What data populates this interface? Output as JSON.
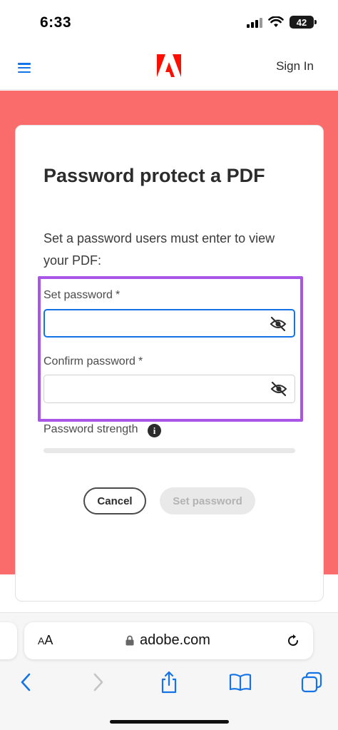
{
  "status_bar": {
    "time": "6:33",
    "battery": "42"
  },
  "header": {
    "sign_in": "Sign In"
  },
  "card": {
    "title": "Password protect a PDF",
    "description": "Set a password users must enter to view your PDF:",
    "set_password": {
      "label": "Set password",
      "required_mark": "*",
      "value": ""
    },
    "confirm_password": {
      "label": "Confirm password",
      "required_mark": "*",
      "value": ""
    },
    "strength_label": "Password strength",
    "info_glyph": "i",
    "cancel_label": "Cancel",
    "set_password_button": "Set password"
  },
  "browser": {
    "aa_label_small": "A",
    "aa_label_large": "A",
    "url": "adobe.com"
  },
  "colors": {
    "accent": "#1473e6",
    "adobe_red": "#fa0f00",
    "backdrop": "#fa6b6b",
    "highlight": "#a855e8"
  },
  "icons": [
    "menu-icon",
    "adobe-logo",
    "eye-slash-icon",
    "info-icon",
    "lock-icon",
    "reload-icon",
    "back-icon",
    "forward-icon",
    "share-icon",
    "bookmarks-icon",
    "tabs-icon"
  ]
}
